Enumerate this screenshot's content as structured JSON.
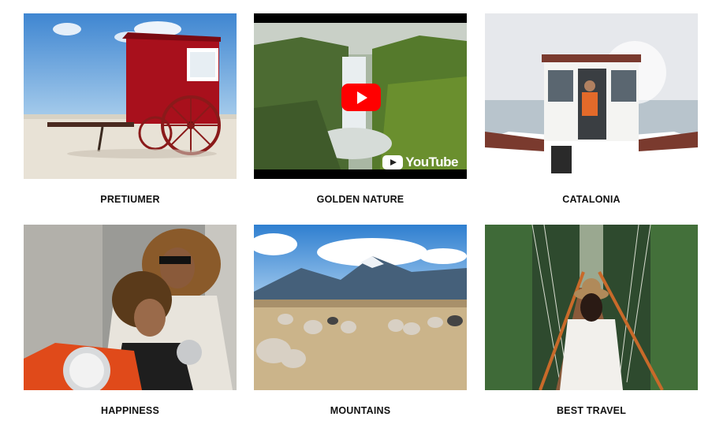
{
  "gallery": {
    "items": [
      {
        "title": "PRETIUMER"
      },
      {
        "title": "GOLDEN NATURE"
      },
      {
        "title": "CATALONIA"
      },
      {
        "title": "HAPPINESS"
      },
      {
        "title": "MOUNTAINS"
      },
      {
        "title": "BEST TRAVEL"
      }
    ]
  },
  "video": {
    "brand_label": "YouTube"
  }
}
